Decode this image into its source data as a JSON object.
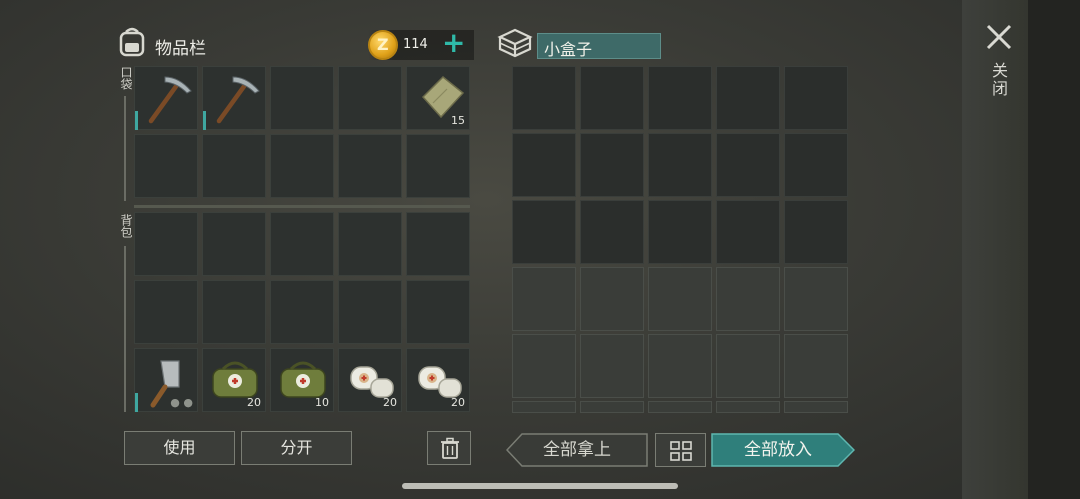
{
  "header": {
    "inventory_title": "物品栏",
    "coins": "114",
    "coin_add": "+",
    "container_name": "小盒子"
  },
  "sections": {
    "pocket_label": "口袋",
    "backpack_label": "背包"
  },
  "close": {
    "label": "关闭"
  },
  "inventory": {
    "pocket_row1": [
      {
        "item": "pickaxe",
        "count": ""
      },
      {
        "item": "pickaxe",
        "count": ""
      },
      {
        "item": "",
        "count": ""
      },
      {
        "item": "",
        "count": ""
      },
      {
        "item": "cloth",
        "count": "15"
      }
    ],
    "bag_row3": [
      {
        "item": "cleaver",
        "count": ""
      },
      {
        "item": "medkit-bag",
        "count": "20"
      },
      {
        "item": "medkit-bag",
        "count": "10"
      },
      {
        "item": "bandage",
        "count": "20"
      },
      {
        "item": "bandage",
        "count": "20"
      }
    ]
  },
  "buttons": {
    "use": "使用",
    "split": "分开",
    "take_all": "全部拿上",
    "put_all": "全部放入"
  },
  "colors": {
    "accent": "#3fa7a0",
    "slot": "#2d312f",
    "field": "#3e6a68"
  }
}
